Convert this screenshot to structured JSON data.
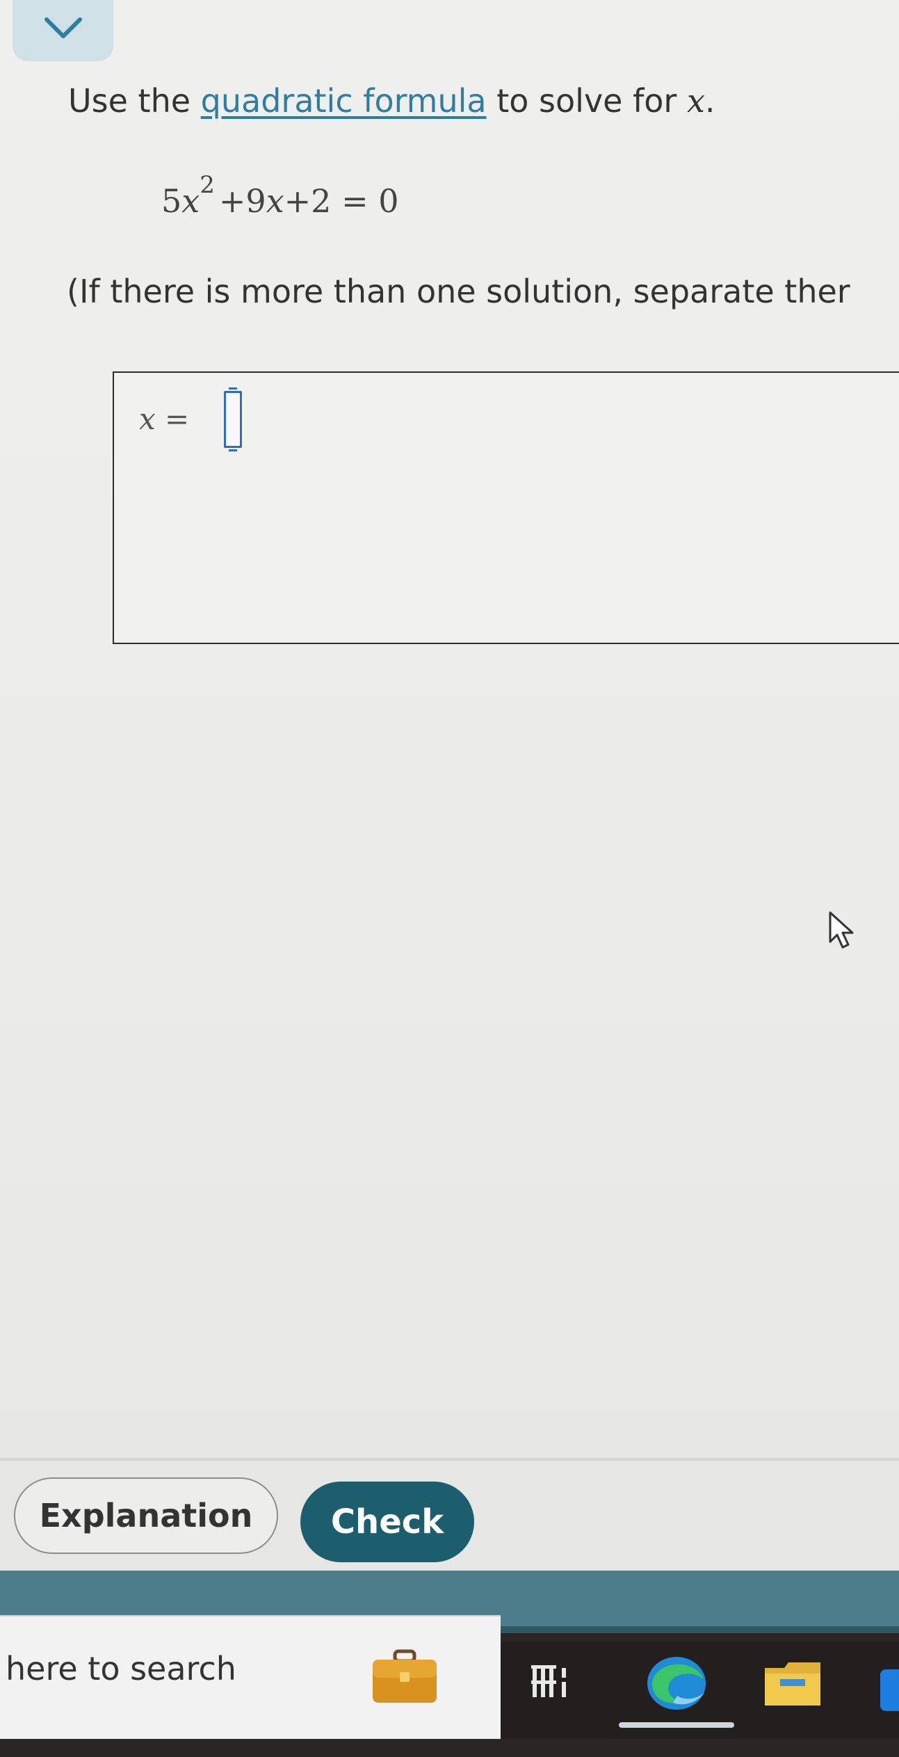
{
  "question": {
    "prefix": "Use the ",
    "link": "quadratic formula",
    "middle": " to solve for ",
    "variable": "x",
    "suffix": "."
  },
  "equation": {
    "coef": "5",
    "var": "x",
    "exp": "2",
    "rest_op": "+9",
    "rest_var": "x",
    "rest_tail": "+2 = 0"
  },
  "instruction": "(If there is more than one solution, separate ther",
  "answer": {
    "var": "x",
    "equals": "=",
    "value": ""
  },
  "buttons": {
    "explanation": "Explanation",
    "check": "Check"
  },
  "taskbar": {
    "search_placeholder": "here to search"
  },
  "colors": {
    "accent": "#1d5e6e",
    "link": "#2f7ea0",
    "input_border": "#2f6fb5",
    "taskbar": "#2a2625"
  },
  "icons": {
    "collapse": "chevron-down-icon",
    "cursor": "mouse-pointer-icon",
    "briefcase": "briefcase-icon",
    "task_view": "task-view-icon",
    "edge": "edge-browser-icon",
    "folder": "file-explorer-icon"
  }
}
